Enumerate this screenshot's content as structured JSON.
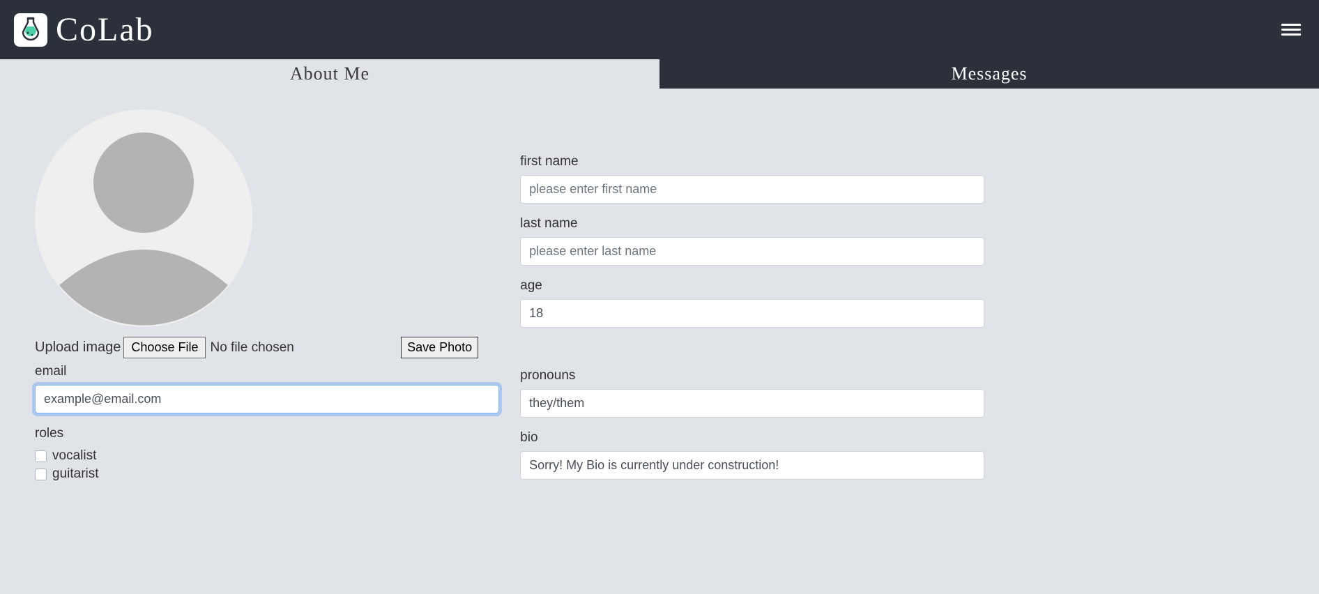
{
  "header": {
    "brand": "CoLab"
  },
  "tabs": {
    "about": "About Me",
    "messages": "Messages"
  },
  "form": {
    "upload_label": "Upload image",
    "choose_file": "Choose File",
    "no_file": "No file chosen",
    "save_photo": "Save Photo",
    "firstname_label": "first name",
    "firstname_placeholder": "please enter first name",
    "lastname_label": "last name",
    "lastname_placeholder": "please enter last name",
    "age_label": "age",
    "age_value": "18",
    "email_label": "email",
    "email_value": "example@email.com",
    "pronouns_label": "pronouns",
    "pronouns_value": "they/them",
    "bio_label": "bio",
    "bio_value": "Sorry! My Bio is currently under construction!",
    "roles_label": "roles",
    "roles": [
      "vocalist",
      "guitarist"
    ]
  }
}
